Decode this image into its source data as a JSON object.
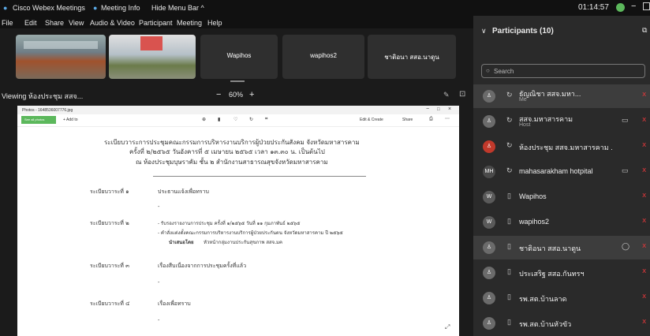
{
  "titlebar": {
    "app": "Cisco Webex Meetings",
    "meeting_info": "Meeting Info",
    "hide_menu": "Hide Menu Bar ^",
    "time": "01:14:57"
  },
  "menu": [
    "File",
    "Edit",
    "Share",
    "View",
    "Audio & Video",
    "Participant",
    "Meeting",
    "Help"
  ],
  "strip": {
    "tiles": [
      "Wapihos",
      "wapihos2",
      "ชาติอนา สสอ.นาดูน"
    ]
  },
  "viewbar": {
    "viewing": "Viewing ห้องประชุม สสจ...",
    "zoom": "60%"
  },
  "share": {
    "window_title": "Photos - 1648536007776.jpg",
    "see_all": "See all photos",
    "add_to": "+ Add to",
    "edit_create": "Edit & Create",
    "share": "Share",
    "heading1": "ระเบียบวาระการประชุมคณะกรรมการบริหารงานบริการผู้ป่วยประกันสังคม จังหวัดมหาสารคาม",
    "heading2": "ครั้งที่ ๒/๒๕๖๕ วันอังคารที่ ๕ เมษายน ๒๕๖๕ เวลา ๑๓.๓๐ น. เป็นต้นไป",
    "heading3": "ณ ห้องประชุมบุษราคัม ชั้น ๒ สำนักงานสาธารณสุขจังหวัดมหาสารคาม",
    "agenda": [
      {
        "label": "ระเบียบวาระที่ ๑",
        "text": "ประธานแจ้งเพื่อทราบ"
      },
      {
        "label": "ระเบียบวาระที่ ๒",
        "text": "- รับรองรายงานการประชุม ครั้งที่ ๑/๒๕๖๕ วันที่ ๑๑ กุมภาพันธ์ ๒๕๖๕"
      },
      {
        "label": "ระเบียบวาระที่ ๓",
        "text": "เรื่องสืบเนื่องจากการประชุมครั้งที่แล้ว"
      },
      {
        "label": "ระเบียบวาระที่ ๔",
        "text": "เรื่องเพื่อทราบ"
      }
    ],
    "agenda2_line2": "- คำสั่งแต่งตั้งคณะกรรมการบริหารงานบริการผู้ป่วยประกันตน จังหวัดมหาสารคาม ปี ๒๕๖๕",
    "agenda2_line3_bold": "นำเสนอโดย",
    "agenda2_line3": "หัวหน้ากลุ่มงานประกันสุขภาพ สสจ.มค",
    "dash": "-"
  },
  "panel": {
    "title": "Participants (10)",
    "search_placeholder": "Search",
    "participants": [
      {
        "name": "ธัญณิชา สสจ.มหา...",
        "sub": "Me"
      },
      {
        "name": "สสจ.มหาสารคาม",
        "sub": "Host"
      },
      {
        "name": "ห้องประชุม สสจ.มหาสารคาม ."
      },
      {
        "name": "mahasarakham hotpital",
        "initials": "MH"
      },
      {
        "name": "Wapihos",
        "initials": "W"
      },
      {
        "name": "wapihos2",
        "initials": "W"
      },
      {
        "name": "ชาติอนา สสอ.นาดูน"
      },
      {
        "name": "ประเสริฐ สสอ.กันทรฯ"
      },
      {
        "name": "รพ.สต.บ้านลาด"
      },
      {
        "name": "รพ.สต.บ้านหัวขัว"
      }
    ]
  },
  "colors": {
    "accent_green": "#5cb85c",
    "mute_red": "#e0383b",
    "panel_bg": "#2a2a2a"
  }
}
